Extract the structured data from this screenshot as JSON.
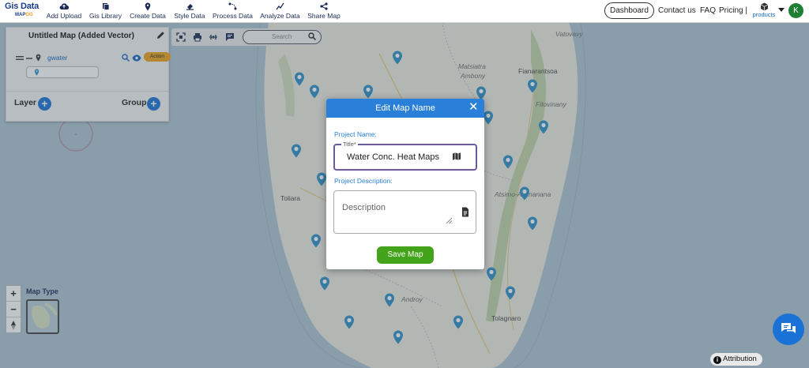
{
  "app": {
    "logo_line1": "Gis Data",
    "logo_line2a": "MAP",
    "logo_line2b": "OG"
  },
  "nav": [
    {
      "label": "Add Upload",
      "icon": "cloud-upload-icon"
    },
    {
      "label": "Gis Library",
      "icon": "library-icon"
    },
    {
      "label": "Create Data",
      "icon": "map-pin-icon"
    },
    {
      "label": "Style Data",
      "icon": "paint-icon"
    },
    {
      "label": "Process Data",
      "icon": "process-icon"
    },
    {
      "label": "Analyze Data",
      "icon": "analyze-icon"
    },
    {
      "label": "Share Map",
      "icon": "share-icon"
    }
  ],
  "header_right": {
    "dashboard": "Dashboard",
    "contact": "Contact us",
    "faq": "FAQ",
    "pricing": "Pricing |",
    "products": "products",
    "avatar_letter": "K"
  },
  "panel": {
    "title": "Untitled Map (Added Vector)",
    "layer_name": "gwater",
    "action_label": "Action",
    "layer_label": "Layer",
    "group_label": "Group"
  },
  "tools": {
    "search_placeholder": "Search"
  },
  "map": {
    "labels": [
      "Vatovavy",
      "Matsiatra",
      "Ambony",
      "Fianarantsoa",
      "Fitovinany",
      "Toliara",
      "Atsimo-Atsinanana",
      "Androy",
      "Tolagnaro"
    ],
    "map_type_label": "Map Type"
  },
  "modal": {
    "title": "Edit Map Name",
    "project_name_label": "Project Name:",
    "title_legend": "Title*",
    "title_value": "Water Conc. Heat Maps",
    "description_label": "Project Description:",
    "description_placeholder": "Description",
    "save_label": "Save Map"
  },
  "footer": {
    "attribution": "Attribution"
  },
  "colors": {
    "accent": "#2a7fd9",
    "save": "#43a31a",
    "action": "#f0a21c",
    "pin": "#2f8fc9"
  }
}
